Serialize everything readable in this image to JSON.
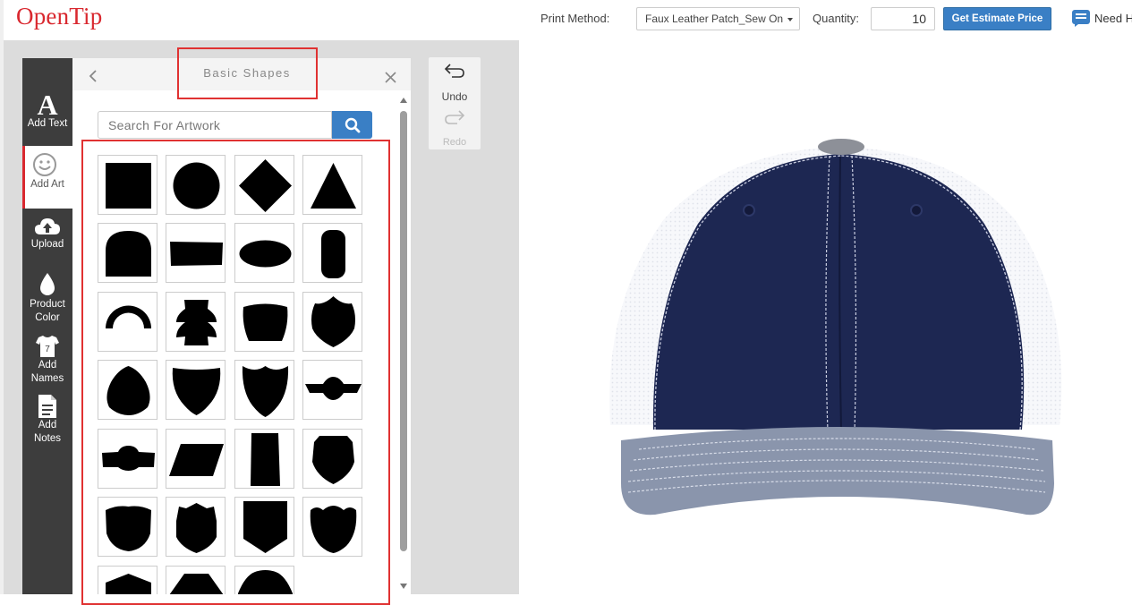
{
  "header": {
    "logo": "OpenTip",
    "print_method_label": "Print Method:",
    "print_method_value": "Faux Leather Patch_Sew On",
    "quantity_label": "Quantity:",
    "quantity_value": "10",
    "estimate_button": "Get Estimate Price",
    "help_text": "Need H"
  },
  "sidebar": {
    "items": [
      {
        "label": "Add Text",
        "icon": "letter-a-icon"
      },
      {
        "label": "Add Art",
        "icon": "smiley-icon"
      },
      {
        "label": "Upload",
        "icon": "cloud-upload-icon"
      },
      {
        "label_line1": "Product",
        "label_line2": "Color",
        "icon": "drop-icon"
      },
      {
        "label_line1": "Add",
        "label_line2": "Names",
        "icon": "jersey-icon"
      },
      {
        "label_line1": "Add",
        "label_line2": "Notes",
        "icon": "note-icon"
      }
    ]
  },
  "panel": {
    "title": "Basic Shapes",
    "search_placeholder": "Search For Artwork"
  },
  "history": {
    "undo_label": "Undo",
    "redo_label": "Redo"
  },
  "colors": {
    "brand_red": "#d9282f",
    "accent_blue": "#3a7fc5",
    "sidebar_dark": "#3d3d3d",
    "highlight_red": "#e03232"
  },
  "shapes": [
    "square",
    "circle",
    "diamond",
    "triangle",
    "arch",
    "rectangle",
    "ellipse",
    "capsule",
    "half-ring",
    "notched-circle",
    "trapezoid-round",
    "police-badge",
    "rounded-shield",
    "curved-shield",
    "pointed-shield",
    "winged-oval",
    "bowler",
    "parallelogram",
    "tall-rectangle",
    "notched-shield",
    "flat-shield",
    "crest-shield",
    "square-shield",
    "scalloped-shield",
    "pentagon-top",
    "trapezoid",
    "trapezoid-rounded"
  ]
}
